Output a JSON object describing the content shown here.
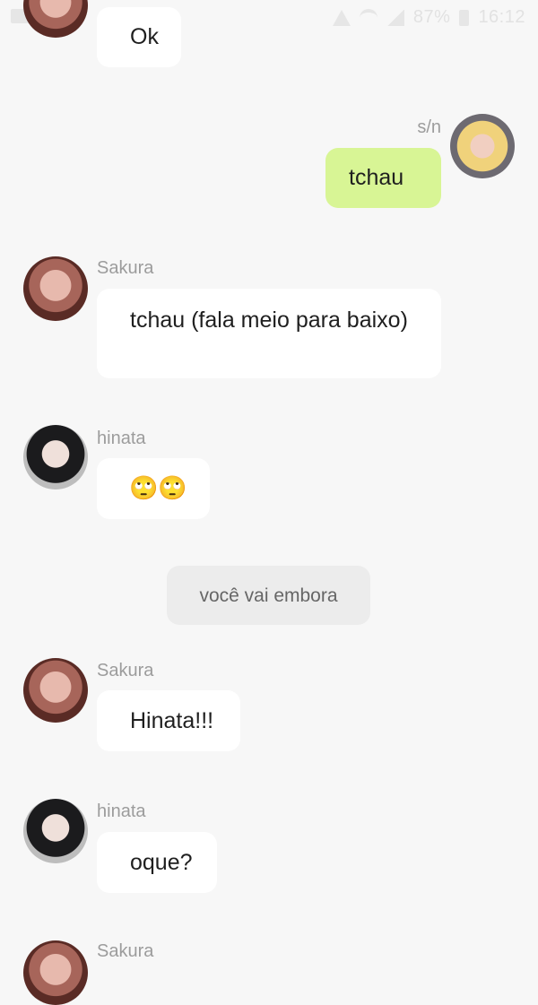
{
  "status_bar": {
    "battery": "87%",
    "time": "16:12"
  },
  "messages": [
    {
      "sender": "",
      "text": "Ok"
    },
    {
      "sender": "s/n",
      "text": "tchau"
    },
    {
      "sender": "Sakura",
      "text": "tchau (fala meio para baixo)"
    },
    {
      "sender": "hinata",
      "text": "🙄🙄"
    },
    {
      "narration": "você vai embora"
    },
    {
      "sender": "Sakura",
      "text": "Hinata!!!"
    },
    {
      "sender": "hinata",
      "text": "oque?"
    },
    {
      "sender": "Sakura",
      "text": ""
    }
  ],
  "colors": {
    "background": "#f7f7f7",
    "own_bubble": "#d8f595",
    "other_bubble": "#ffffff",
    "name": "#9c9c9c"
  }
}
